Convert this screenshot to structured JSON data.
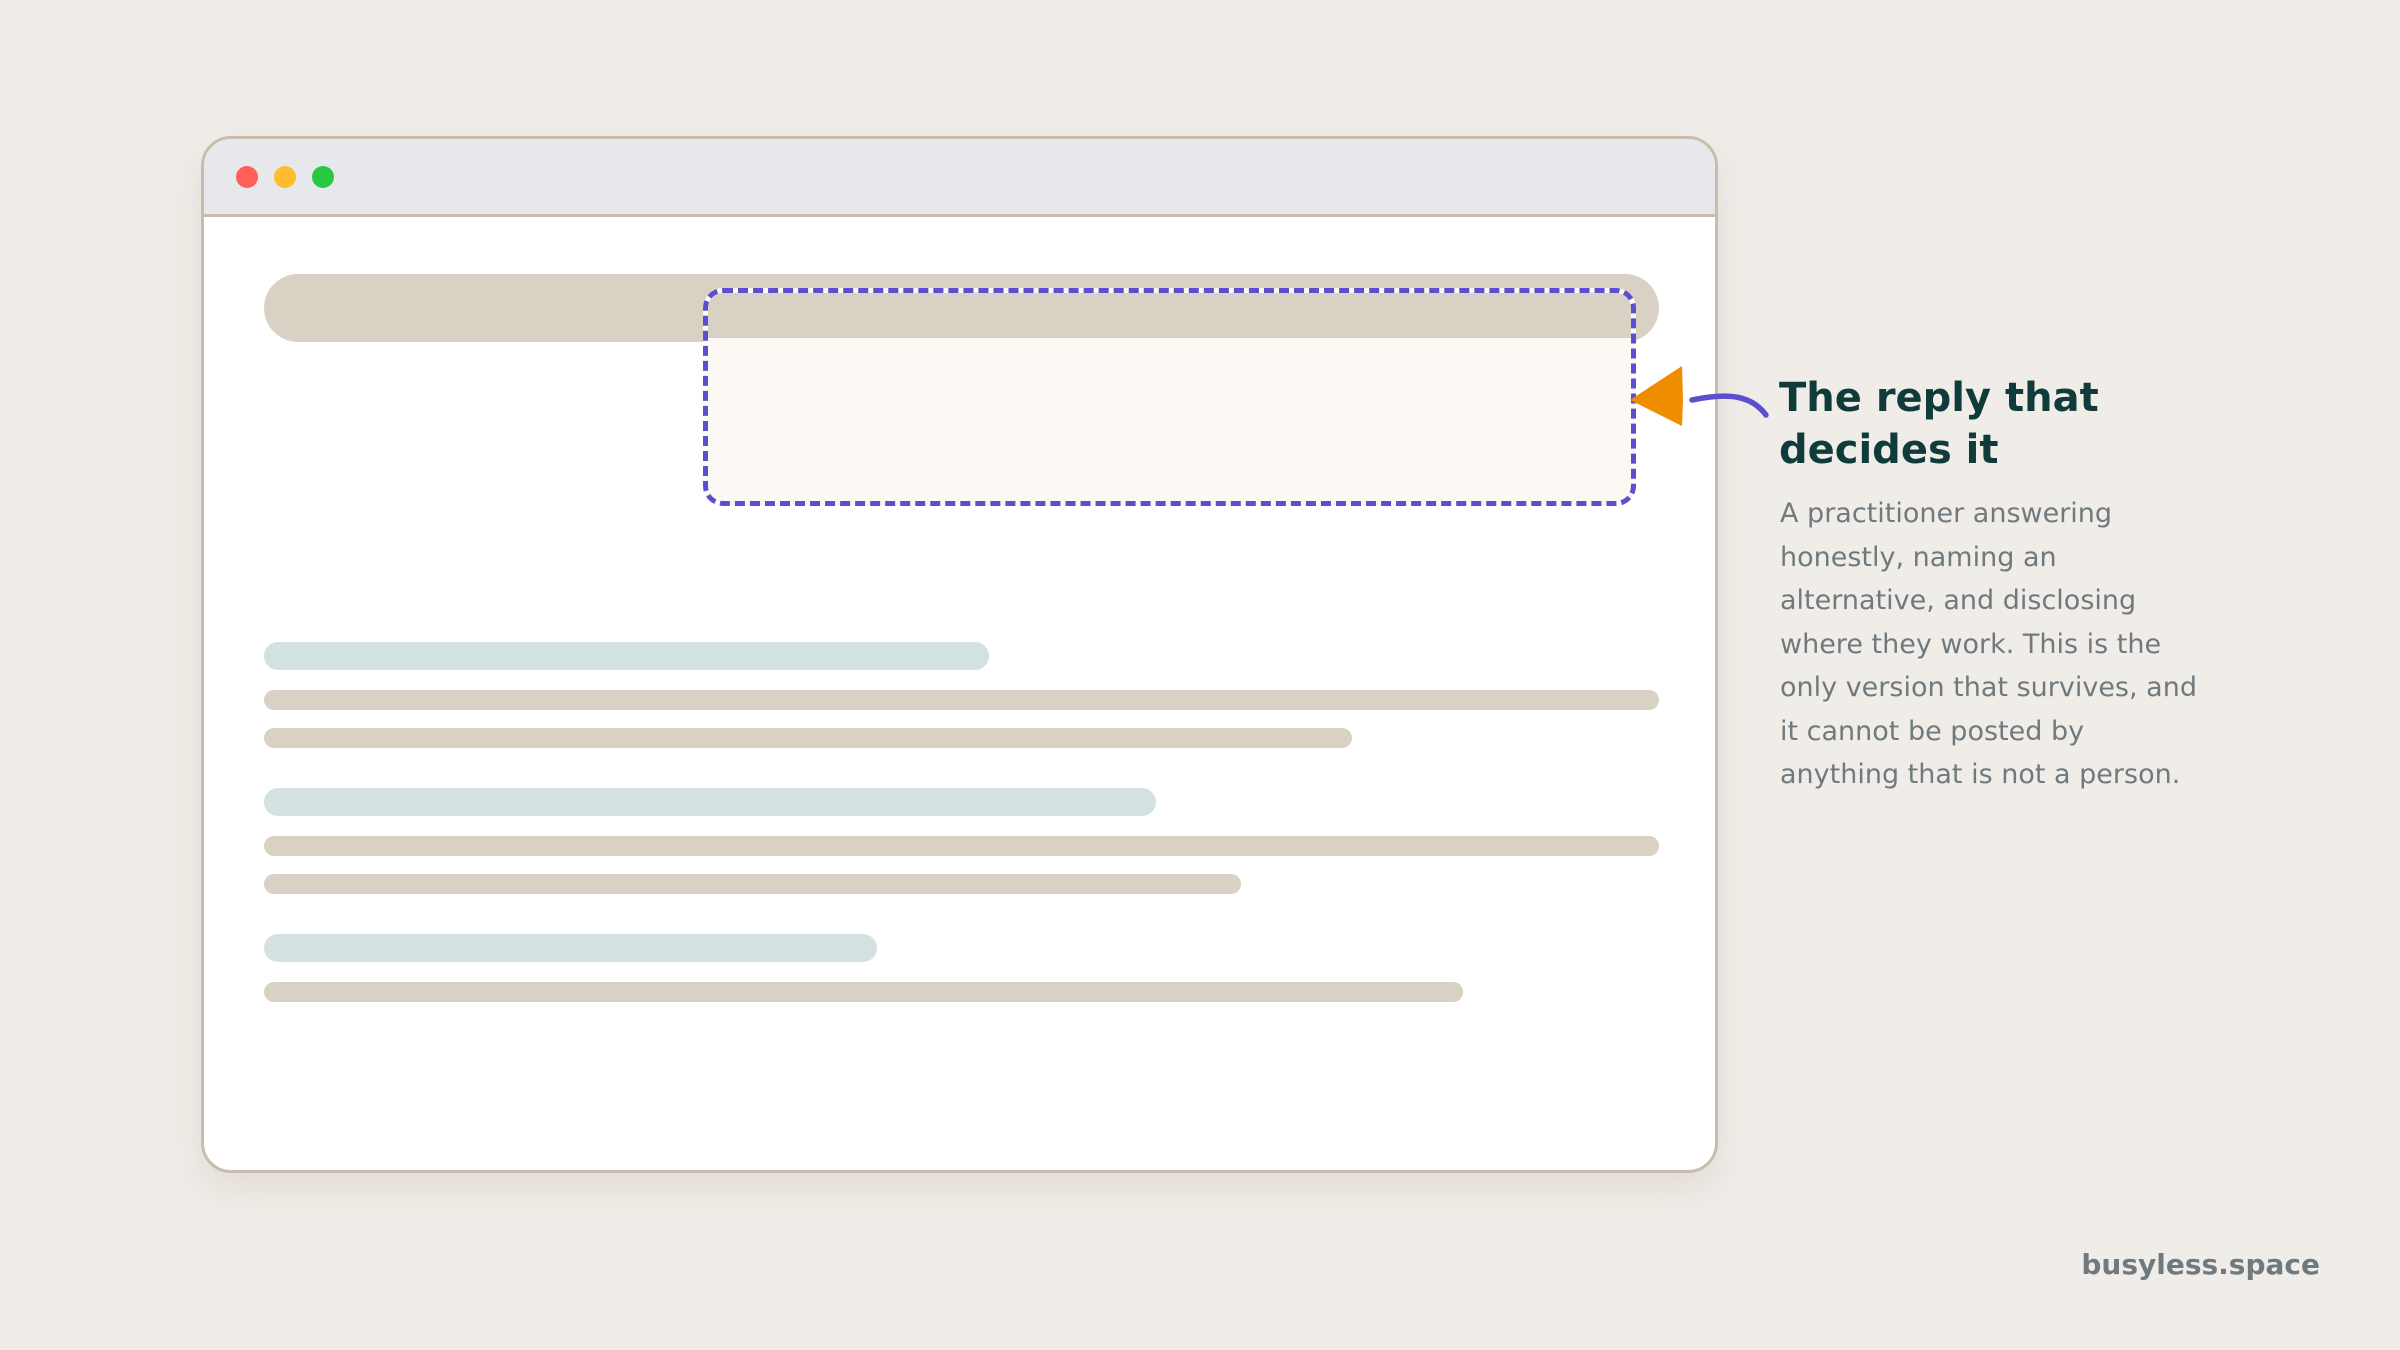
{
  "window": {
    "controls": [
      "close",
      "minimize",
      "maximize"
    ]
  },
  "colors": {
    "background": "#F0EDE8",
    "window_border": "#C8BCAE",
    "title_bar": "#E6E8EC",
    "placeholder_beige": "#D9D1C4",
    "placeholder_teal": "#D3E1E1",
    "highlight_dashed": "#5B4FCF",
    "arrow_orange": "#F08C00",
    "title_text": "#0F3B3A",
    "body_text": "#707A7E"
  },
  "annotation": {
    "title": "The reply that decides it",
    "body": "A practitioner answering honestly, naming an alternative, and disclosing where they work. This is the only version that survives, and it cannot be posted by anything that is not a person."
  },
  "footer": {
    "brand": "busyless.space"
  }
}
